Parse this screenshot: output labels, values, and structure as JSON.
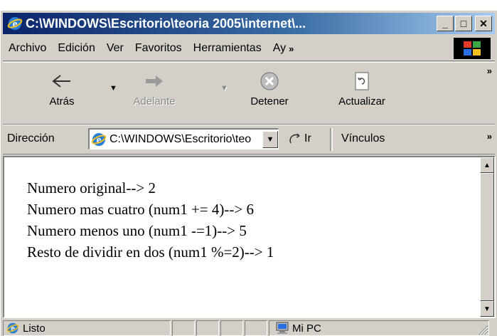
{
  "top_label": "Ventana del navegador",
  "window": {
    "title": "C:\\WINDOWS\\Escritorio\\teoria 2005\\internet\\...",
    "buttons": {
      "minimize": "_",
      "maximize": "□",
      "close": "✕"
    }
  },
  "menubar": {
    "items": [
      {
        "label": "Archivo"
      },
      {
        "label": "Edición"
      },
      {
        "label": "Ver"
      },
      {
        "label": "Favoritos"
      },
      {
        "label": "Herramientas"
      },
      {
        "label": "Ay"
      }
    ],
    "overflow": "»"
  },
  "toolbar": {
    "back": "Atrás",
    "forward": "Adelante",
    "stop": "Detener",
    "refresh": "Actualizar",
    "overflow": "»"
  },
  "address": {
    "label": "Dirección",
    "value": "C:\\WINDOWS\\Escritorio\\teo",
    "go": "Ir",
    "links": "Vínculos",
    "overflow": "»"
  },
  "content": {
    "lines": [
      "Numero original--> 2",
      "Numero mas cuatro (num1 += 4)--> 6",
      "Numero menos uno (num1 -=1)--> 5",
      "Resto de dividir en dos (num1 %=2)--> 1"
    ]
  },
  "status": {
    "text": "Listo",
    "zone": "Mi PC"
  },
  "colors": {
    "title_start": "#0a246a",
    "title_end": "#a6caf0",
    "chrome": "#d4d0c8"
  }
}
